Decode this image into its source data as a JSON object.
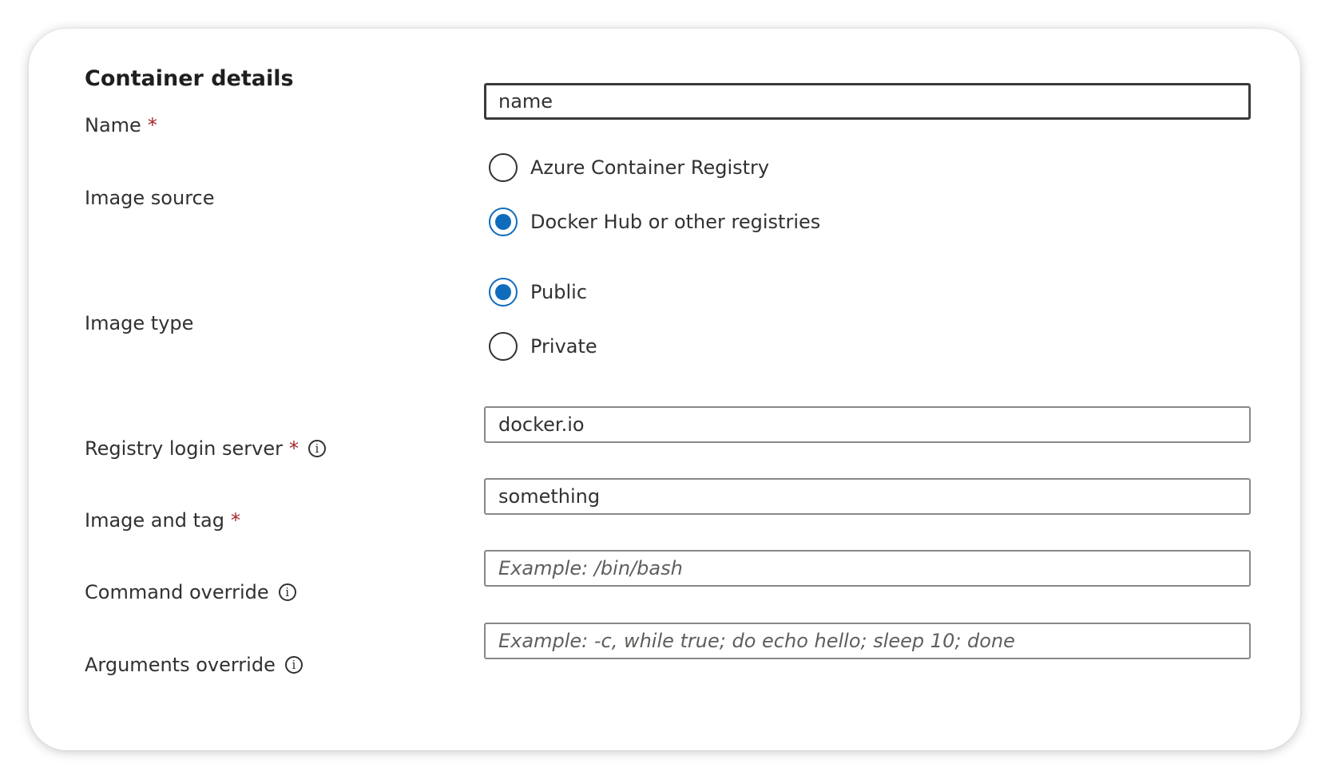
{
  "section": {
    "title": "Container details"
  },
  "fields": {
    "name": {
      "label": "Name",
      "required_mark": "*",
      "value": "name"
    },
    "image_source": {
      "label": "Image source",
      "options": [
        {
          "label": "Azure Container Registry",
          "selected": false
        },
        {
          "label": "Docker Hub or other registries",
          "selected": true
        }
      ]
    },
    "image_type": {
      "label": "Image type",
      "options": [
        {
          "label": "Public",
          "selected": true
        },
        {
          "label": "Private",
          "selected": false
        }
      ]
    },
    "registry_login_server": {
      "label": "Registry login server",
      "required_mark": "*",
      "info_icon": "info-icon",
      "value": "docker.io"
    },
    "image_and_tag": {
      "label": "Image and tag",
      "required_mark": "*",
      "value": "something"
    },
    "command_override": {
      "label": "Command override",
      "info_icon": "info-icon",
      "value": "",
      "placeholder": "Example: /bin/bash"
    },
    "arguments_override": {
      "label": "Arguments override",
      "info_icon": "info-icon",
      "value": "",
      "placeholder": "Example: -c, while true; do echo hello; sleep 10; done"
    }
  },
  "colors": {
    "accent": "#0f6cbd",
    "required": "#a4262c",
    "text": "#323130",
    "border": "#8a8886"
  }
}
